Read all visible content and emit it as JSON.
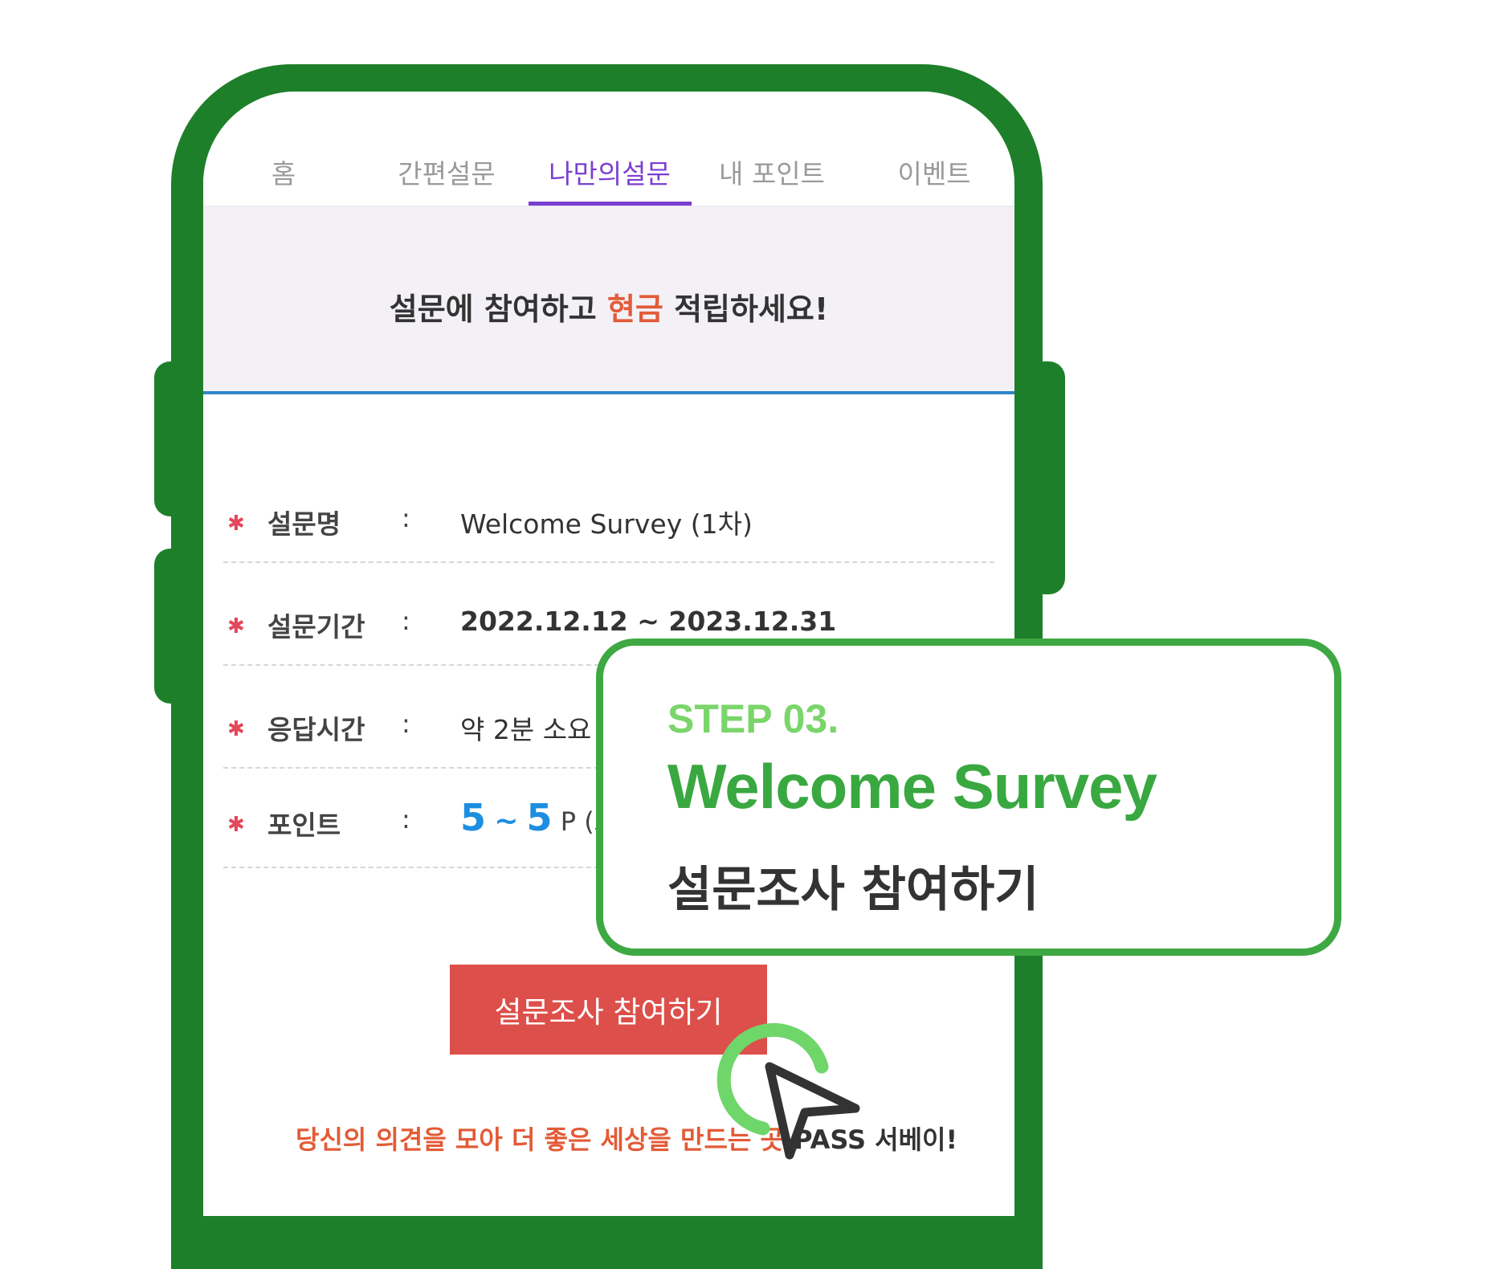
{
  "tabs": [
    {
      "label": "홈",
      "active": false
    },
    {
      "label": "간편설문",
      "active": false
    },
    {
      "label": "나만의설문",
      "active": true
    },
    {
      "label": "내 포인트",
      "active": false
    },
    {
      "label": "이벤트",
      "active": false
    }
  ],
  "banner": {
    "prefix": "설문에 참여하고 ",
    "highlight": "현금",
    "suffix": " 적립하세요!"
  },
  "survey": {
    "name": {
      "label": "설문명",
      "separator": ":",
      "value": "Welcome Survey (1차)"
    },
    "period": {
      "label": "설문기간",
      "separator": ":",
      "value": "2022.12.12 ~ 2023.12.31"
    },
    "time": {
      "label": "응답시간",
      "separator": ":",
      "value": "약 2분 소요"
    },
    "points": {
      "label": "포인트",
      "separator": ":",
      "min": "5",
      "tilde": "~",
      "max": "5",
      "unit": "P (조"
    }
  },
  "join_button": "설문조사 참여하기",
  "slogan": {
    "prefix": "당신의 의견을 모아 더 좋은 세상을 만드는 곳,",
    "suffix": "PASS 서베이!"
  },
  "callout": {
    "step": "STEP 03.",
    "title": "Welcome Survey",
    "subtitle": "설문조사 참여하기"
  },
  "icons": {
    "cursor": "cursor-arrow-icon",
    "click": "click-ring-icon"
  },
  "colors": {
    "phone_frame": "#1e7f2a",
    "accent_green": "#3ea843",
    "tab_active": "#7b3fd0",
    "button": "#dd4f4a",
    "highlight": "#e25b37",
    "points": "#1d8ee0"
  }
}
